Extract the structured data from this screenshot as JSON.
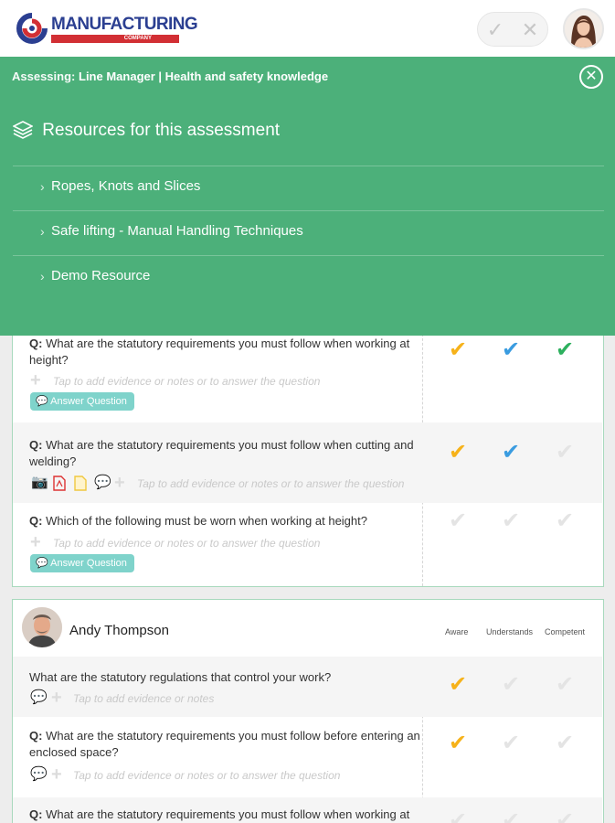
{
  "header": {
    "logo_text": "MANUFACTURING",
    "logo_sub": "COMPANY",
    "accept_icon": "check-icon",
    "reject_icon": "close-icon"
  },
  "panel": {
    "assessing_label": "Assessing:",
    "assessing_value": "Line Manager | Health and safety knowledge",
    "close_icon": "close-circle-icon",
    "resources_title": "Resources for this assessment",
    "resources": [
      {
        "label": "Ropes, Knots and Slices"
      },
      {
        "label": "Safe lifting - Manual Handling Techniques"
      },
      {
        "label": "Demo Resource"
      }
    ],
    "color": "#4cb07a"
  },
  "card1": {
    "rows": [
      {
        "prefix": "Q:",
        "text": "What are the statutory requirements you must follow when working at height?",
        "hint": "Tap to add evidence or notes or to answer the question",
        "action": "Answer Question",
        "ratings": [
          "orange",
          "blue",
          "green"
        ]
      },
      {
        "prefix": "Q:",
        "text": "What are the statutory requirements you must follow when cutting and welding?",
        "hint": "Tap to add evidence or notes or to answer the question",
        "ratings": [
          "orange",
          "blue",
          "grey"
        ]
      },
      {
        "prefix": "Q:",
        "text": "Which of the following must be worn when working at height?",
        "hint": "Tap to add evidence or notes or to answer the question",
        "action": "Answer Question",
        "ratings": [
          "grey",
          "grey",
          "grey"
        ]
      }
    ]
  },
  "card2": {
    "name": "Andy Thompson",
    "columns": [
      "Aware",
      "Understands",
      "Competent"
    ],
    "rows": [
      {
        "text": "What are the statutory regulations that control your work?",
        "hint": "Tap to add evidence or notes",
        "ratings": [
          "orange",
          "grey",
          "grey"
        ]
      },
      {
        "prefix": "Q:",
        "text": "What are the statutory requirements you must follow before entering an enclosed space?",
        "hint": "Tap to add evidence or notes or to answer the question",
        "ratings": [
          "orange",
          "grey",
          "grey"
        ]
      },
      {
        "prefix": "Q:",
        "text": "What are the statutory requirements you must follow when working at",
        "ratings": [
          "grey",
          "grey",
          "grey"
        ]
      }
    ]
  },
  "colors": {
    "orange": "#f6b21a",
    "blue": "#3a9ce0",
    "green": "#2db05e",
    "grey": "#e4e4e4",
    "answer_button": "#7fd3cb"
  }
}
